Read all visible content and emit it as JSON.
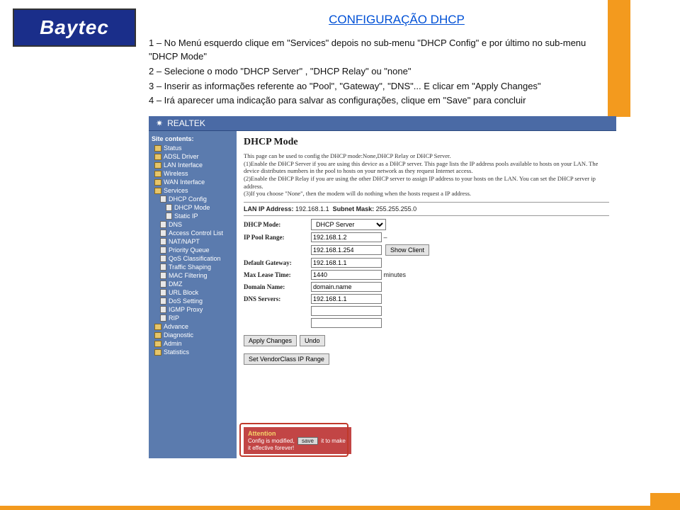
{
  "logo_text": "Baytec",
  "title": "CONFIGURAÇÃO DHCP",
  "instructions": {
    "line1": "1 – No Menú esquerdo  clique em \"Services\" depois no sub-menu \"DHCP Config\" e por último no sub-menu \"DHCP Mode\"",
    "line2": "2 – Selecione o modo \"DHCP Server\" , \"DHCP Relay\" ou \"none\"",
    "line3": "3 – Inserir as informações referente ao \"Pool\", \"Gateway\", \"DNS\"... E clicar em \"Apply Changes\"",
    "line4": "4 – Irá aparecer uma indicação para salvar as configurações, clique em \"Save\" para concluir"
  },
  "shot": {
    "brand": "REALTEK",
    "nav_heading": "Site contents:",
    "nav": [
      {
        "t": "item",
        "l": "Status"
      },
      {
        "t": "item",
        "l": "ADSL Driver"
      },
      {
        "t": "item",
        "l": "LAN Interface"
      },
      {
        "t": "item",
        "l": "Wireless"
      },
      {
        "t": "item",
        "l": "WAN Interface"
      },
      {
        "t": "item",
        "l": "Services"
      },
      {
        "t": "sub",
        "l": "DHCP Config"
      },
      {
        "t": "sub2",
        "l": "DHCP Mode"
      },
      {
        "t": "sub2",
        "l": "Static IP"
      },
      {
        "t": "sub",
        "l": "DNS"
      },
      {
        "t": "sub",
        "l": "Access Control List"
      },
      {
        "t": "sub",
        "l": "NAT/NAPT"
      },
      {
        "t": "sub",
        "l": "Priority Queue"
      },
      {
        "t": "sub",
        "l": "QoS Classification"
      },
      {
        "t": "sub",
        "l": "Traffic Shaping"
      },
      {
        "t": "sub",
        "l": "MAC Filtering"
      },
      {
        "t": "sub",
        "l": "DMZ"
      },
      {
        "t": "sub",
        "l": "URL Block"
      },
      {
        "t": "sub",
        "l": "DoS Setting"
      },
      {
        "t": "sub",
        "l": "IGMP Proxy"
      },
      {
        "t": "sub",
        "l": "RIP"
      },
      {
        "t": "item",
        "l": "Advance"
      },
      {
        "t": "item",
        "l": "Diagnostic"
      },
      {
        "t": "item",
        "l": "Admin"
      },
      {
        "t": "item",
        "l": "Statistics"
      }
    ],
    "page_title": "DHCP Mode",
    "desc": "This page can be used to config the DHCP mode:None,DHCP Relay or DHCP Server.\n(1)Enable the DHCP Server if you are using this device as a DHCP server. This page lists the IP address pools available to hosts on your LAN. The device distributes numbers in the pool to hosts on your network as they request Internet access.\n(2)Enable the DHCP Relay if you are using the other DHCP server to assign IP address to your hosts on the LAN. You can set the DHCP server ip address.\n(3)If you choose \"None\", then the modem will do nothing when the hosts request a IP address.",
    "lan_ip_label": "LAN IP Address:",
    "lan_ip": "192.168.1.1",
    "subnet_label": "Subnet Mask:",
    "subnet": "255.255.255.0",
    "fields": {
      "mode_label": "DHCP Mode:",
      "mode_value": "DHCP Server",
      "pool_label": "IP Pool Range:",
      "pool_start": "192.168.1.2",
      "pool_sep": "–",
      "pool_end": "192.168.1.254",
      "show_client": "Show Client",
      "gw_label": "Default Gateway:",
      "gw_value": "192.168.1.1",
      "lease_label": "Max Lease Time:",
      "lease_value": "1440",
      "lease_unit": "minutes",
      "domain_label": "Domain Name:",
      "domain_value": "domain.name",
      "dns_label": "DNS Servers:",
      "dns_value": "192.168.1.1"
    },
    "buttons": {
      "apply": "Apply Changes",
      "undo": "Undo",
      "vendor": "Set VendorClass IP Range"
    },
    "attention": {
      "title": "Attention",
      "text1": "Config is modified,",
      "save": "save",
      "text2": "it to make it effective forever!"
    }
  }
}
